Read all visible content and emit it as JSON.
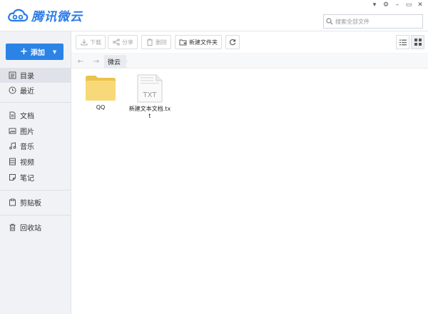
{
  "app": {
    "title": "腾讯微云"
  },
  "window_controls": {
    "dropdown": "▾",
    "settings": "⚙",
    "minimize": "–",
    "maximize": "▭",
    "close": "✕"
  },
  "search": {
    "placeholder": "搜索全部文件",
    "value": ""
  },
  "sidebar": {
    "add_button": {
      "plus": "+",
      "label": "添加",
      "caret": "▼"
    },
    "items": [
      {
        "label": "目录",
        "icon": "list-icon",
        "active": true
      },
      {
        "label": "最近",
        "icon": "clock-icon"
      },
      {
        "label": "文档",
        "icon": "document-icon"
      },
      {
        "label": "图片",
        "icon": "image-icon"
      },
      {
        "label": "音乐",
        "icon": "music-icon"
      },
      {
        "label": "视频",
        "icon": "video-icon"
      },
      {
        "label": "笔记",
        "icon": "note-icon"
      },
      {
        "label": "剪贴板",
        "icon": "clipboard-icon"
      },
      {
        "label": "回收站",
        "icon": "trash-icon"
      }
    ]
  },
  "toolbar": {
    "download": "下载",
    "share": "分享",
    "delete": "删除",
    "new_folder": "新建文件夹",
    "refresh_icon": "refresh-icon",
    "list_view_icon": "list-view-icon",
    "grid_view_icon": "grid-view-icon",
    "active_view": "grid"
  },
  "path": {
    "back": "←",
    "forward": "→",
    "crumbs": [
      "微云"
    ]
  },
  "files": [
    {
      "name": "QQ",
      "type": "folder",
      "icon": "folder-icon"
    },
    {
      "name": "新建文本文档.txt",
      "type": "txt",
      "icon": "txt-file-icon",
      "badge": "TXT"
    }
  ],
  "colors": {
    "accent": "#2c83e7",
    "sidebar_bg": "#f0f2f5",
    "folder": "#f7d56b"
  }
}
